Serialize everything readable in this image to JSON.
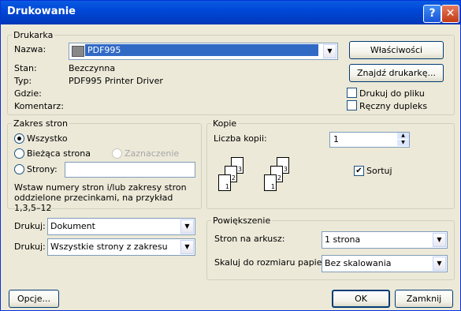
{
  "title": "Drukowanie",
  "title_buttons": {
    "help": "?",
    "close": "✕"
  },
  "printer": {
    "legend": "Drukarka",
    "name_label": "Nazwa:",
    "name_value": "PDF995",
    "status_label": "Stan:",
    "status_value": "Bezczynna",
    "type_label": "Typ:",
    "type_value": "PDF995 Printer Driver",
    "where_label": "Gdzie:",
    "comment_label": "Komentarz:",
    "properties_button": "Właściwości",
    "find_button": "Znajdź drukarkę...",
    "print_to_file": "Drukuj do pliku",
    "manual_duplex": "Ręczny dupleks",
    "print_to_file_checked": false,
    "manual_duplex_checked": false
  },
  "range": {
    "legend": "Zakres stron",
    "all": "Wszystko",
    "current": "Bieżąca strona",
    "selection": "Zaznaczenie",
    "pages": "Strony:",
    "pages_value": "",
    "selected": "all",
    "hint": "Wstaw numery stron i/lub zakresy stron oddzielone przecinkami, na przykład 1,3,5–12"
  },
  "copies": {
    "legend": "Kopie",
    "count_label": "Liczba kopii:",
    "count_value": "1",
    "collate": "Sortuj",
    "collate_checked": true,
    "page_numbers": [
      "1",
      "2",
      "3"
    ]
  },
  "print_what": {
    "label": "Drukuj:",
    "value": "Dokument"
  },
  "print_pages": {
    "label": "Drukuj:",
    "value": "Wszystkie strony z zakresu"
  },
  "zoom": {
    "legend": "Powiększenie",
    "pages_per_sheet_label": "Stron na arkusz:",
    "pages_per_sheet_value": "1 strona",
    "scale_label": "Skaluj do rozmiaru papieru:",
    "scale_value": "Bez skalowania"
  },
  "buttons": {
    "options": "Opcje...",
    "ok": "OK",
    "cancel": "Zamknij"
  },
  "check_glyph": "✔",
  "icons": {
    "dropdown": "dropdown-arrow-icon",
    "printer": "printer-icon"
  }
}
